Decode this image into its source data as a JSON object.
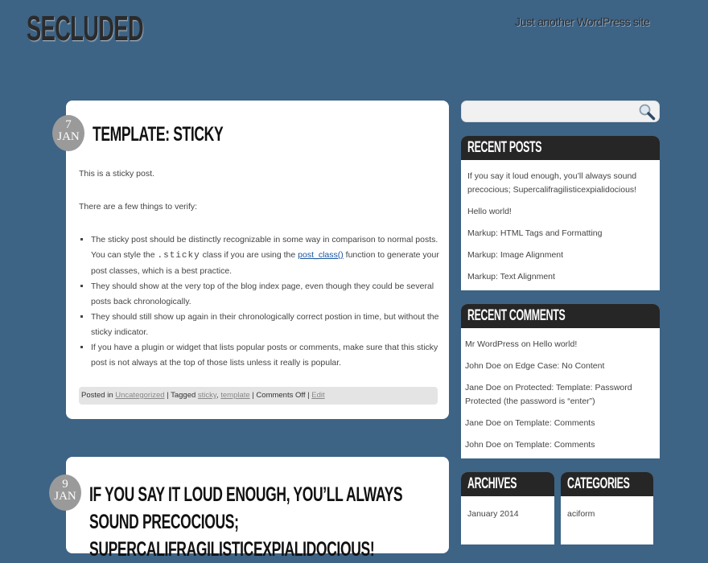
{
  "site": {
    "title": "SECLUDED",
    "tagline": "Just another WordPress site"
  },
  "posts": [
    {
      "day": "7",
      "month": "JAN",
      "title": "Template: Sticky",
      "intro1": "This is a sticky post.",
      "intro2": "There are a few things to verify:",
      "bullet1_a": "The sticky post should be distinctly recognizable in some way in comparison to normal posts. You can style the ",
      "bullet1_code": ".sticky",
      "bullet1_b": " class if you are using the ",
      "bullet1_link": "post_class()",
      "bullet1_c": " function to generate your post classes, which is a best practice.",
      "bullet2": "They should show at the very top of the blog index page, even though they could be several posts back chronologically.",
      "bullet3": "They should still show up again in their chronologically correct postion in time, but without the sticky indicator.",
      "bullet4": "If you have a plugin or widget that lists popular posts or comments, make sure that this sticky post is not always at the top of those lists unless it really is popular.",
      "meta": {
        "posted_in": "Posted in ",
        "category": "Uncategorized",
        "tagged": " | Tagged ",
        "tag1": "sticky",
        "comma": ", ",
        "tag2": "template",
        "comments": " | Comments Off | ",
        "edit": "Edit"
      }
    },
    {
      "day": "9",
      "month": "JAN",
      "title": "If you say it loud enough, you’ll always sound precocious; Supercalifragilisticexpialidocious!"
    }
  ],
  "sidebar": {
    "search_placeholder": "",
    "recent_posts": {
      "title": "Recent Posts",
      "items": [
        "If you say it loud enough, you’ll always sound precocious; Supercalifragilisticexpialidocious!",
        "Hello world!",
        "Markup: HTML Tags and Formatting",
        "Markup: Image Alignment",
        "Markup: Text Alignment"
      ]
    },
    "recent_comments": {
      "title": "Recent Comments",
      "items": [
        "Mr WordPress on Hello world!",
        "John Doe on Edge Case: No Content",
        "Jane Doe on Protected: Template: Password Protected (the password is “enter”)",
        "Jane Doe on Template: Comments",
        "John Doe on Template: Comments"
      ]
    },
    "archives": {
      "title": "Archives",
      "items": [
        "January 2014"
      ]
    },
    "categories": {
      "title": "Categories",
      "items": [
        "aciform"
      ]
    }
  }
}
